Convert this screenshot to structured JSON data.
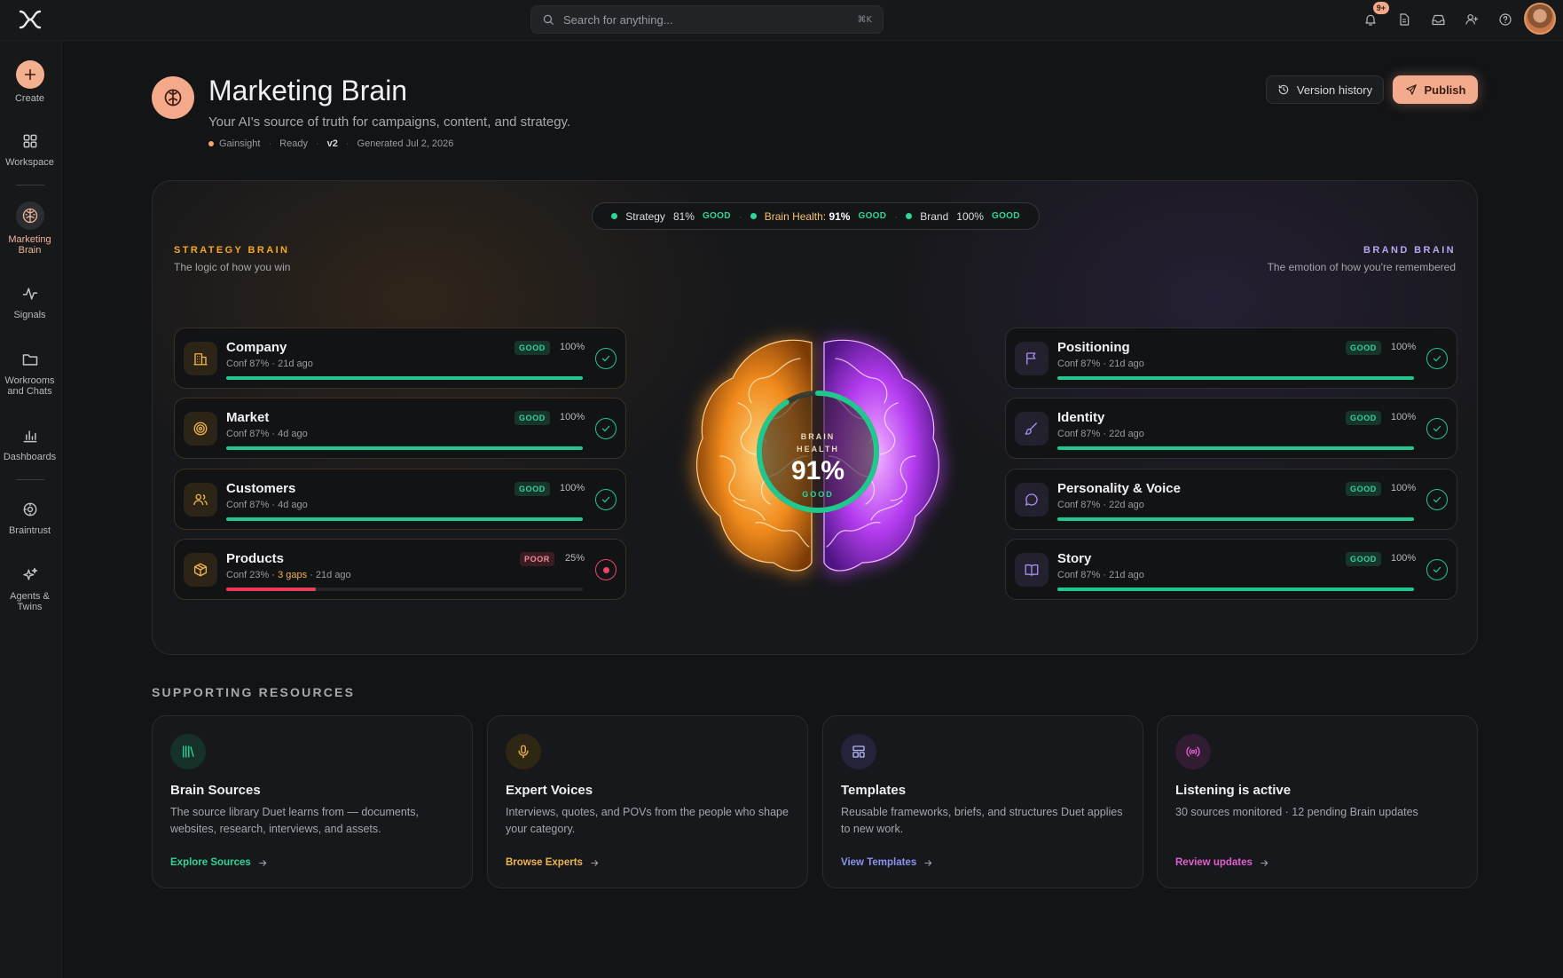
{
  "topbar": {
    "search_placeholder": "Search for anything...",
    "shortcut": "⌘K",
    "notifications_count": "9+",
    "icons": [
      "bell-icon",
      "document-icon",
      "inbox-icon",
      "add-user-icon",
      "help-icon"
    ]
  },
  "sidebar": {
    "items": [
      {
        "label": "Create",
        "icon": "plus-icon"
      },
      {
        "label": "Workspace",
        "icon": "grid-icon"
      },
      {
        "label": "Marketing Brain",
        "icon": "brain-icon",
        "active": true
      },
      {
        "label": "Signals",
        "icon": "pulse-icon"
      },
      {
        "label": "Workrooms and Chats",
        "icon": "folder-icon"
      },
      {
        "label": "Dashboards",
        "icon": "bar-chart-icon"
      },
      {
        "label": "Braintrust",
        "icon": "braintrust-icon"
      },
      {
        "label": "Agents & Twins",
        "icon": "sparkles-icon"
      }
    ]
  },
  "header": {
    "title": "Marketing Brain",
    "subtitle": "Your AI's source of truth for campaigns, content, and strategy.",
    "meta": {
      "org": "Gainsight",
      "status": "Ready",
      "version": "v2",
      "generated": "Generated Jul 2, 2026"
    },
    "version_history_label": "Version history",
    "publish_label": "Publish"
  },
  "summary_pill": {
    "strategy_label": "Strategy",
    "strategy_value": "81%",
    "strategy_status": "GOOD",
    "health_label": "Brain Health:",
    "health_value": "91%",
    "health_status": "GOOD",
    "brand_label": "Brand",
    "brand_value": "100%",
    "brand_status": "GOOD"
  },
  "strategy_brain": {
    "kicker": "STRATEGY BRAIN",
    "description": "The logic of how you win",
    "cards": [
      {
        "title": "Company",
        "conf": "Conf 87%",
        "gaps": "",
        "age": "· 21d ago",
        "status": "GOOD",
        "pct": "100%",
        "progress": 1.0,
        "icon": "building-icon"
      },
      {
        "title": "Market",
        "conf": "Conf 87%",
        "gaps": "",
        "age": "· 4d ago",
        "status": "GOOD",
        "pct": "100%",
        "progress": 1.0,
        "icon": "target-icon"
      },
      {
        "title": "Customers",
        "conf": "Conf 87%",
        "gaps": "",
        "age": "· 4d ago",
        "status": "GOOD",
        "pct": "100%",
        "progress": 1.0,
        "icon": "users-icon"
      },
      {
        "title": "Products",
        "conf": "Conf 23%",
        "gaps": "· 3 gaps",
        "age": "· 21d ago",
        "status": "POOR",
        "pct": "25%",
        "progress": 0.25,
        "icon": "box-icon"
      }
    ]
  },
  "brand_brain": {
    "kicker": "BRAND BRAIN",
    "description": "The emotion of how you're remembered",
    "cards": [
      {
        "title": "Positioning",
        "conf": "Conf 87%",
        "age": "· 21d ago",
        "status": "GOOD",
        "pct": "100%",
        "progress": 1.0,
        "icon": "flag-icon"
      },
      {
        "title": "Identity",
        "conf": "Conf 87%",
        "age": "· 22d ago",
        "status": "GOOD",
        "pct": "100%",
        "progress": 1.0,
        "icon": "brush-icon"
      },
      {
        "title": "Personality & Voice",
        "conf": "Conf 87%",
        "age": "· 22d ago",
        "status": "GOOD",
        "pct": "100%",
        "progress": 1.0,
        "icon": "chat-bubble-icon"
      },
      {
        "title": "Story",
        "conf": "Conf 87%",
        "age": "· 21d ago",
        "status": "GOOD",
        "pct": "100%",
        "progress": 1.0,
        "icon": "book-icon"
      }
    ]
  },
  "brain_gauge": {
    "label_line1": "BRAIN",
    "label_line2": "HEALTH",
    "value": "91%",
    "status": "GOOD",
    "progress": 0.91
  },
  "resources": {
    "title": "SUPPORTING RESOURCES",
    "cards": [
      {
        "title": "Brain Sources",
        "desc": "The source library Duet learns from — documents, websites, research, interviews, and assets.",
        "link": "Explore Sources",
        "icon": "library-icon",
        "color": "#2ed69a"
      },
      {
        "title": "Expert Voices",
        "desc": "Interviews, quotes, and POVs from the people who shape your category.",
        "link": "Browse Experts",
        "icon": "microphone-icon",
        "color": "#f0b34a"
      },
      {
        "title": "Templates",
        "desc": "Reusable frameworks, briefs, and structures Duet applies to new work.",
        "link": "View Templates",
        "icon": "layout-icon",
        "color": "#8b93f0"
      },
      {
        "title": "Listening is active",
        "desc": "30 sources monitored · 12 pending Brain updates",
        "link": "Review updates",
        "icon": "broadcast-icon",
        "color": "#e25fd0"
      }
    ]
  },
  "colors": {
    "accent": "#f3ab8d",
    "good": "#22c78e",
    "poor": "#ef4468",
    "strategy": "#f5a623",
    "brand": "#b18cf5"
  }
}
